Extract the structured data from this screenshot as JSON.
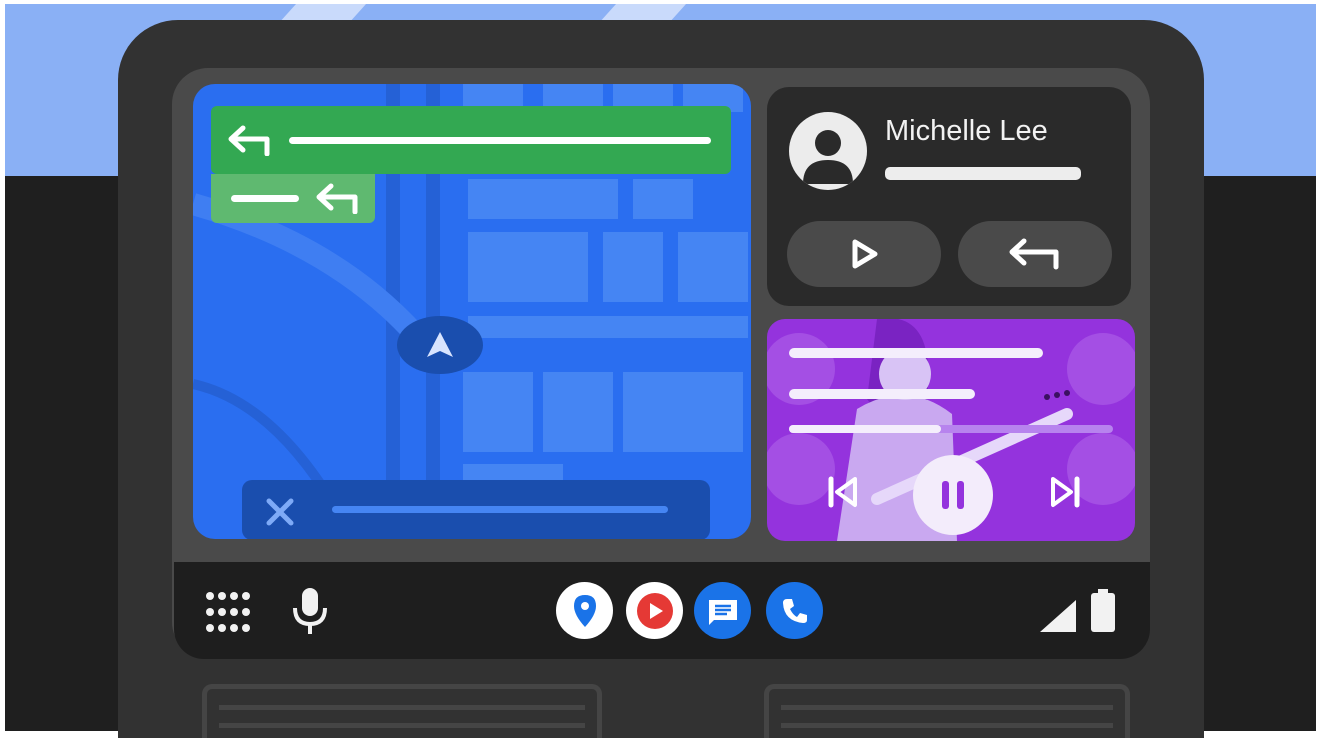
{
  "contact_card": {
    "name": "Michelle Lee",
    "avatar_icon": "person-avatar-icon",
    "play_icon": "play-icon",
    "reply_icon": "reply-arrow-icon"
  },
  "navigation": {
    "maneuver_icon": "turn-left-arrow-icon",
    "next_maneuver_icon": "turn-left-arrow-icon",
    "location_icon": "navigation-arrow-icon",
    "close_icon": "close-x-icon"
  },
  "media_player": {
    "previous_icon": "skip-previous-icon",
    "pause_icon": "pause-icon",
    "next_icon": "skip-next-icon"
  },
  "taskbar": {
    "launcher_icon": "app-grid-icon",
    "mic_icon": "microphone-icon",
    "apps": [
      {
        "name": "maps",
        "icon": "map-pin-icon",
        "color": "#1a73e8"
      },
      {
        "name": "youtube-music",
        "icon": "play-circle-icon",
        "color": "#e53935"
      },
      {
        "name": "messages",
        "icon": "message-icon",
        "color": "#1a73e8"
      },
      {
        "name": "phone",
        "icon": "phone-icon",
        "color": "#1a73e8"
      }
    ],
    "signal_icon": "signal-icon",
    "battery_icon": "battery-icon"
  },
  "colors": {
    "map": "#2a6ef0",
    "turn_card": "#33a852",
    "media_card": "#9433dd",
    "dashboard": "#1f1f1f"
  }
}
